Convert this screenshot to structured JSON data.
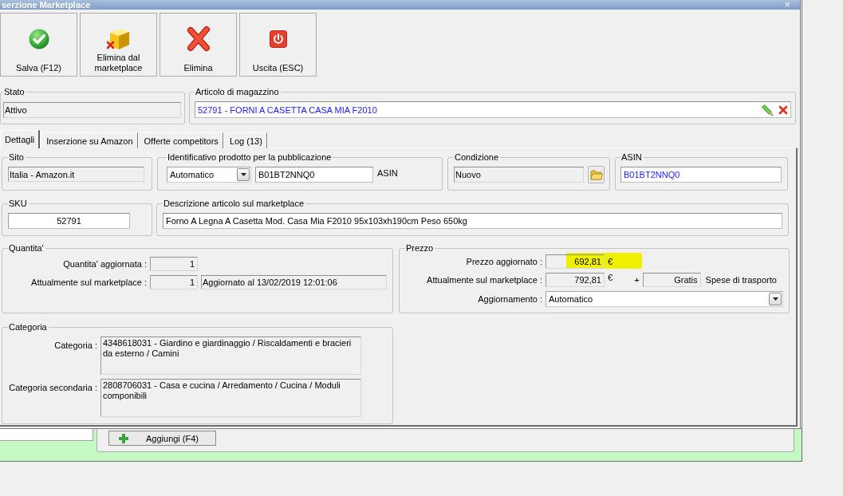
{
  "window": {
    "title": "serzione Marketplace",
    "close": "×"
  },
  "toolbar": [
    {
      "kind": "save",
      "label": "Salva (F12)"
    },
    {
      "kind": "unlist",
      "label": "Elimina dal marketplace"
    },
    {
      "kind": "delete",
      "label": "Elimina"
    },
    {
      "kind": "exit",
      "label": "Uscita (ESC)"
    }
  ],
  "stato": {
    "label": "Stato",
    "value": "Attivo"
  },
  "articolo": {
    "label": "Articolo di magazzino",
    "value": "52791 - FORNI A CASETTA CASA MIA F2010"
  },
  "tabs": [
    {
      "label": "Dettagli",
      "selected": true
    },
    {
      "label": "Inserzione su Amazon",
      "selected": false
    },
    {
      "label": "Offerte competitors",
      "selected": false
    },
    {
      "label": "Log (13)",
      "selected": false
    }
  ],
  "sito": {
    "label": "Sito",
    "value": "Italia - Amazon.it"
  },
  "identificativo": {
    "label": "Identificativo prodotto per la pubblicazione",
    "mode": "Automatico",
    "code": "B01BT2NNQ0",
    "code_type": "ASIN"
  },
  "condizione": {
    "label": "Condizione",
    "value": "Nuovo"
  },
  "asin": {
    "label": "ASIN",
    "value": "B01BT2NNQ0"
  },
  "sku": {
    "label": "SKU",
    "value": "52791"
  },
  "descrizione": {
    "label": "Descrizione articolo sul marketplace",
    "value": "Forno A Legna A Casetta Mod. Casa Mia F2010 95x103xh190cm Peso 650kg"
  },
  "quantita": {
    "label": "Quantita'",
    "updated": {
      "label": "Quantita' aggiornata :",
      "value": "1"
    },
    "current": {
      "label": "Attualmente sul marketplace :",
      "value": "1",
      "note": "Aggiornato al 13/02/2019 12:01:06"
    }
  },
  "prezzo": {
    "label": "Prezzo",
    "updated": {
      "label": "Prezzo aggiornato :",
      "value": "692,81",
      "currency": "€",
      "highlighted": true
    },
    "current": {
      "label": "Attualmente sul marketplace :",
      "value": "792,81",
      "currency": "€",
      "plus": "+",
      "shipping": "Gratis",
      "shipping_label": "Spese di trasporto"
    },
    "update_mode": {
      "label": "Aggiornamento :",
      "value": "Automatico"
    }
  },
  "categoria": {
    "label": "Categoria",
    "rows": [
      {
        "label": "Categoria :",
        "value": "4348618031 - Giardino e giardinaggio / Riscaldamenti e bracieri da esterno / Camini"
      },
      {
        "label": "Categoria secondaria :",
        "value": "2808706031 - Casa e cucina / Arredamento / Cucina / Moduli componibili"
      }
    ]
  },
  "background_window": {
    "add_button": "Aggiungi (F4)"
  }
}
